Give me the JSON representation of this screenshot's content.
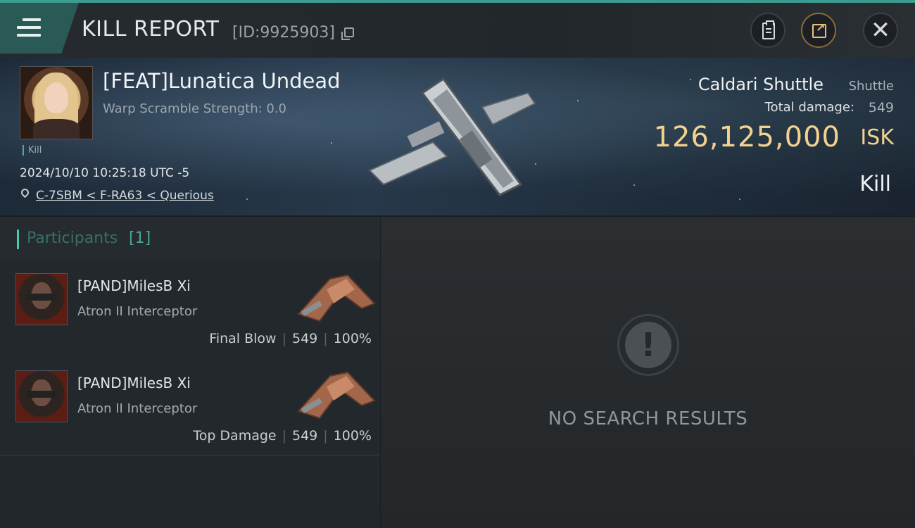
{
  "header": {
    "title": "KILL REPORT",
    "report_id": "[ID:9925903]",
    "icons": [
      "menu-icon",
      "copy-icon",
      "clipboard-icon",
      "share-icon",
      "close-icon"
    ]
  },
  "victim": {
    "name": "[FEAT]Lunatica Undead",
    "warp_scramble": "Warp Scramble Strength: 0.0",
    "tag": "Kill",
    "datetime": "2024/10/10 10:25:18 UTC -5",
    "location": "C-7SBM < F-RA63 < Querious"
  },
  "ship": {
    "name": "Caldari Shuttle",
    "class": "Shuttle",
    "damage_label": "Total damage:",
    "damage_value": "549",
    "isk_value": "126,125,000",
    "isk_unit": "ISK",
    "result": "Kill"
  },
  "participants": {
    "title": "Participants",
    "count": "[1]",
    "rows": [
      {
        "name": "[PAND]MilesB Xi",
        "ship": "Atron II Interceptor",
        "role": "Final Blow",
        "damage": "549",
        "percent": "100%"
      },
      {
        "name": "[PAND]MilesB Xi",
        "ship": "Atron II Interceptor",
        "role": "Top Damage",
        "damage": "549",
        "percent": "100%"
      }
    ]
  },
  "results": {
    "empty_text": "NO SEARCH RESULTS"
  },
  "colors": {
    "accent": "#3b9c8f",
    "isk_gold": "#f2d28f",
    "panel_bg": "#22272c"
  }
}
